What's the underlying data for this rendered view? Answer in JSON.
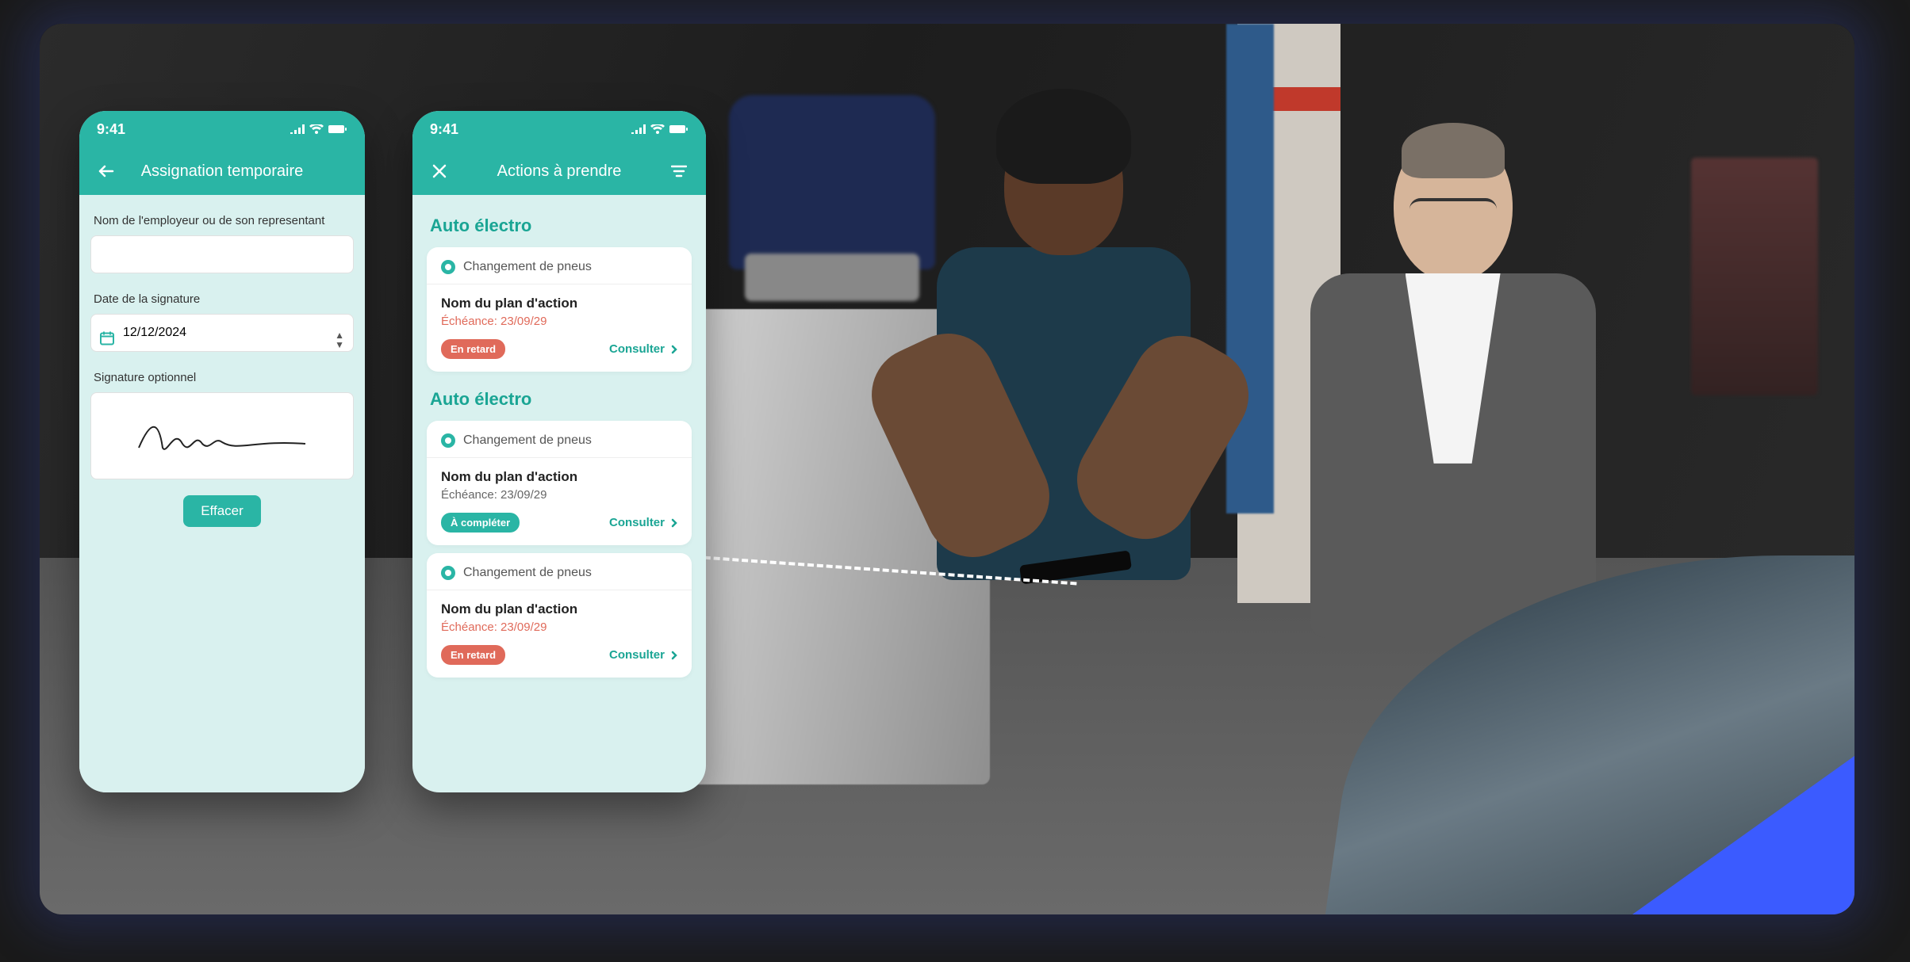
{
  "statusTime": "9:41",
  "phone1": {
    "title": "Assignation temporaire",
    "employerLabel": "Nom de l'employeur ou de son representant",
    "dateLabel": "Date de la signature",
    "dateValue": "12/12/2024",
    "sigLabel": "Signature optionnel",
    "clearBtn": "Effacer"
  },
  "phone2": {
    "title": "Actions à prendre",
    "sections": [
      {
        "heading": "Auto électro",
        "cards": [
          {
            "task": "Changement de pneus",
            "plan": "Nom du plan d'action",
            "deadlinePrefix": "Échéance: ",
            "deadlineDate": "23/09/29",
            "late": true,
            "badge": "En retard",
            "consult": "Consulter"
          }
        ]
      },
      {
        "heading": "Auto électro",
        "cards": [
          {
            "task": "Changement de pneus",
            "plan": "Nom du plan d'action",
            "deadlinePrefix": "Échéance: ",
            "deadlineDate": "23/09/29",
            "late": false,
            "badge": "À compléter",
            "consult": "Consulter"
          },
          {
            "task": "Changement de pneus",
            "plan": "Nom du plan d'action",
            "deadlinePrefix": "Échéance: ",
            "deadlineDate": "23/09/29",
            "late": true,
            "badge": "En retard",
            "consult": "Consulter"
          }
        ]
      }
    ]
  }
}
